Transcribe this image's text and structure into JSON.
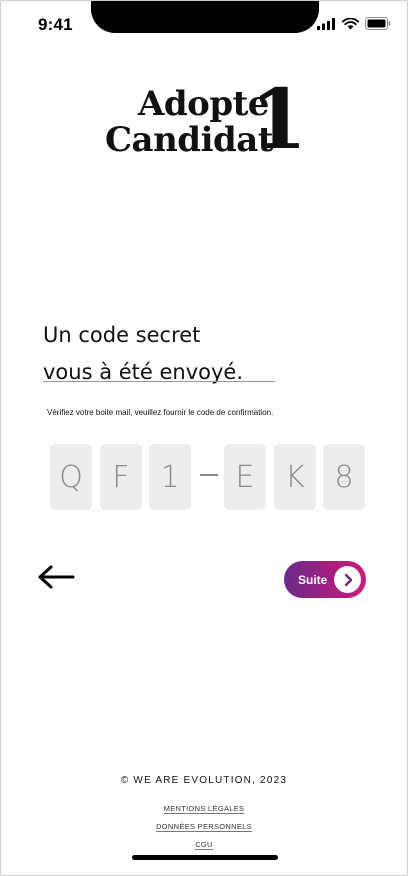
{
  "status_bar": {
    "time": "9:41"
  },
  "logo": {
    "line1": "Adopte",
    "line2": "Candidat",
    "number": "1"
  },
  "heading": {
    "line1": "Un code secret",
    "line2": "vous à été envoyé."
  },
  "instruction": "Vérifiez votre boite mail, veuillez fournir le code de confirmation.",
  "code": {
    "chars": [
      "Q",
      "F",
      "1",
      "E",
      "K",
      "8"
    ],
    "separator": "-"
  },
  "actions": {
    "next_label": "Suite"
  },
  "footer": {
    "copyright": "© WE ARE EVOLUTION,  2023",
    "links": [
      "MENTIONS LÉGALES",
      "DONNÉES PERSONNELS",
      "CGU"
    ]
  },
  "colors": {
    "accent_start": "#6a2a8a",
    "accent_end": "#d0187a",
    "code_box_bg": "#ededed"
  }
}
